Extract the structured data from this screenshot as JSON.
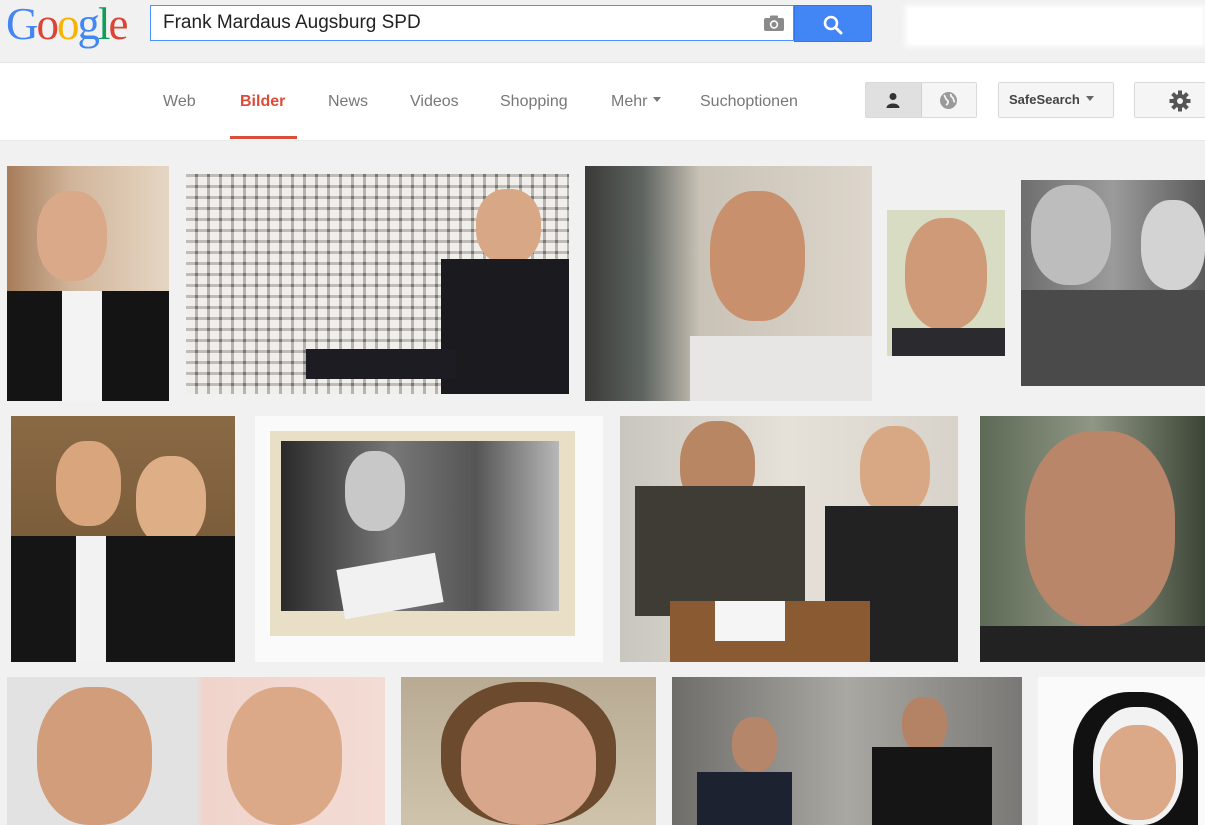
{
  "logo": {
    "letters": [
      "G",
      "o",
      "o",
      "g",
      "l",
      "e"
    ],
    "colors": [
      "#4285f4",
      "#db4437",
      "#f4b400",
      "#4285f4",
      "#0f9d58",
      "#db4437"
    ]
  },
  "search": {
    "query": "Frank Mardaus Augsburg SPD",
    "camera_icon": "camera-icon",
    "button_icon": "search-icon"
  },
  "nav": {
    "tabs": [
      {
        "label": "Web"
      },
      {
        "label": "Bilder"
      },
      {
        "label": "News"
      },
      {
        "label": "Videos"
      },
      {
        "label": "Shopping"
      },
      {
        "label": "Mehr"
      },
      {
        "label": "Suchoptionen"
      }
    ],
    "active_tab": "Bilder",
    "safesearch_label": "SafeSearch",
    "mode_icons": [
      "person-icon",
      "globe-icon"
    ],
    "settings_icon": "gear-icon"
  },
  "colors": {
    "accent": "#dd4b39",
    "search_blue": "#4285f4",
    "tab_text": "#777777"
  },
  "images": {
    "row1": [
      "man in suit portrait",
      "man at photo wall",
      "man with glasses by window",
      "smiling man close-up",
      "couple black and white photo"
    ],
    "row2": [
      "man and woman at event",
      "black and white photo woman with letter",
      "two men talking at table",
      "man face close-up"
    ],
    "row3": [
      "two men portraits",
      "woman with short hair",
      "two men in dark room",
      "nun portrait"
    ]
  }
}
